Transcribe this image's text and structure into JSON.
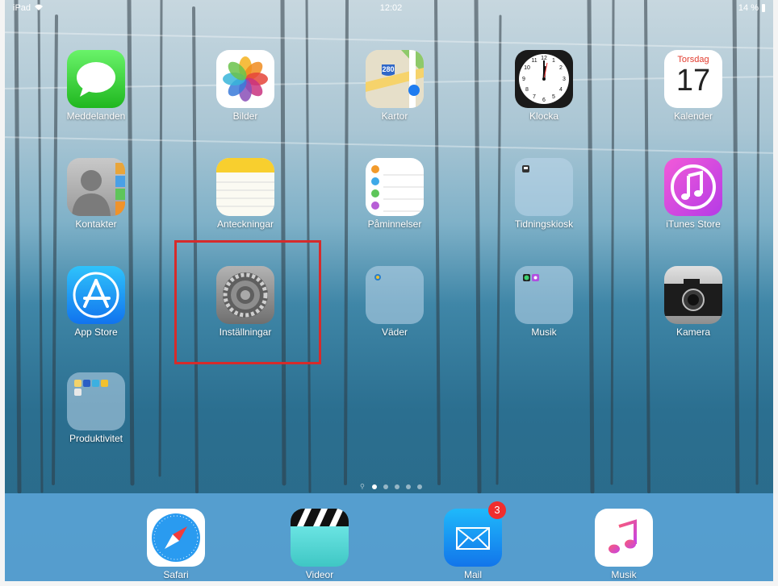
{
  "status": {
    "device": "iPad",
    "time": "12:02",
    "battery": "14 %"
  },
  "apps": {
    "messages": "Meddelanden",
    "photos": "Bilder",
    "maps": "Kartor",
    "maps_shield": "280",
    "clock": "Klocka",
    "calendar": "Kalender",
    "calendar_day": "Torsdag",
    "calendar_date": "17",
    "contacts": "Kontakter",
    "notes": "Anteckningar",
    "reminders": "Påminnelser",
    "newsstand": "Tidningskiosk",
    "itunes": "iTunes Store",
    "appstore": "App Store",
    "settings": "Inställningar",
    "weather": "Väder",
    "music_folder": "Musik",
    "camera": "Kamera",
    "productivity": "Produktivitet"
  },
  "dock": {
    "safari": "Safari",
    "videos": "Videor",
    "mail": "Mail",
    "mail_badge": "3",
    "music": "Musik"
  },
  "colors": {
    "highlight": "#d62b2b",
    "badge": "#f02e2e"
  },
  "page_indicator": {
    "pages": 5,
    "active": 1
  }
}
